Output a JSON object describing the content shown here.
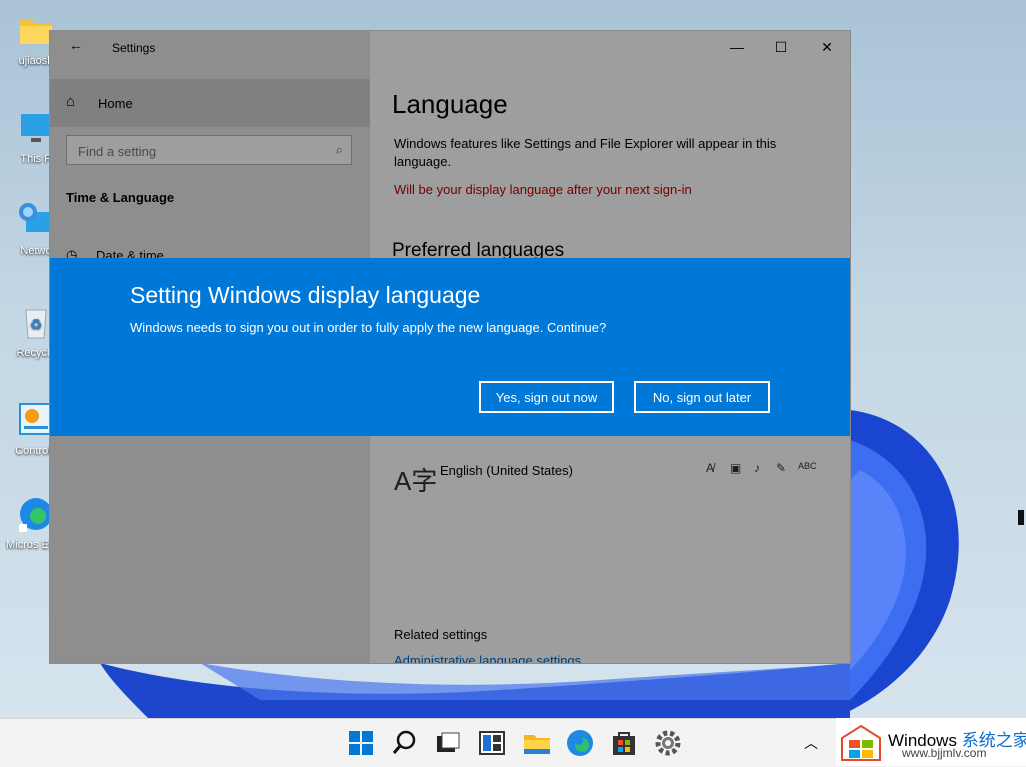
{
  "desktop": {
    "icons": [
      {
        "label": "ujiaosh",
        "icon": "folder-icon"
      },
      {
        "label": "This P",
        "icon": "computer-icon"
      },
      {
        "label": "Netwo",
        "icon": "network-icon"
      },
      {
        "label": "Recycle",
        "icon": "recycle-bin-icon"
      },
      {
        "label": "Control I",
        "icon": "control-panel-icon"
      },
      {
        "label": "Micros Edge",
        "icon": "edge-icon"
      }
    ]
  },
  "window": {
    "title": "Settings",
    "left": {
      "home_label": "Home",
      "search_placeholder": "Find a setting",
      "section_title": "Time & Language",
      "nav_item_date": "Date & time"
    },
    "content": {
      "heading": "Language",
      "description": "Windows features like Settings and File Explorer will appear in this language.",
      "notice": "Will be your display language after your next sign-in",
      "preferred_heading": "Preferred languages",
      "language_name": "English (United States)",
      "related_heading": "Related settings",
      "admin_link": "Administrative language settings"
    }
  },
  "dialog": {
    "title": "Setting Windows display language",
    "message": "Windows needs to sign you out in order to fully apply the new language. Continue?",
    "yes_label": "Yes, sign out now",
    "no_label": "No, sign out later"
  },
  "taskbar": {
    "items": [
      "start-icon",
      "search-icon",
      "task-view-icon",
      "widgets-icon",
      "file-explorer-icon",
      "edge-icon",
      "store-icon",
      "settings-icon"
    ]
  },
  "watermark": {
    "brand": "Windows",
    "brand_cn": "系统之家",
    "url": "www.bjjmlv.com"
  },
  "colors": {
    "accent": "#0078d7",
    "notice": "#c00000"
  }
}
